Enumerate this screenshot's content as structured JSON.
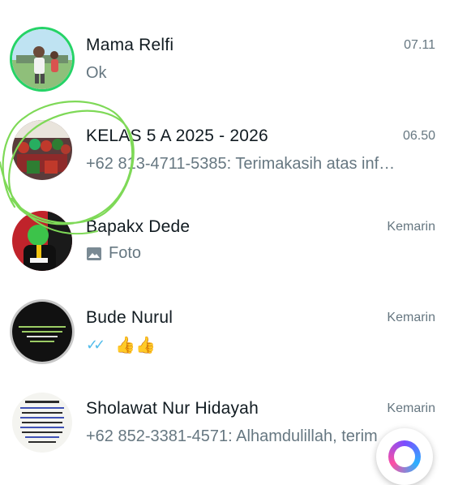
{
  "chats": [
    {
      "name": "Mama Relfi",
      "time": "07.11",
      "preview": "Ok"
    },
    {
      "name": "KELAS 5 A 2025 - 2026",
      "time": "06.50",
      "preview": "+62 813-4711-5385: Terimakasih atas inf…"
    },
    {
      "name": "Bapakx Dede",
      "time": "Kemarin",
      "preview": "Foto",
      "preview_icon": "photo-icon"
    },
    {
      "name": "Bude Nurul",
      "time": "Kemarin",
      "preview": "👍👍",
      "preview_icon": "double-check-icon",
      "tick_color": "#53bdeb"
    },
    {
      "name": "Sholawat Nur Hidayah",
      "time": "Kemarin",
      "preview": "+62 852-3381-4571: Alhamdulillah, terim"
    }
  ],
  "colors": {
    "status_ring": "#25d366",
    "scribble": "#7ed957",
    "name": "#111b21",
    "secondary": "#667781"
  }
}
